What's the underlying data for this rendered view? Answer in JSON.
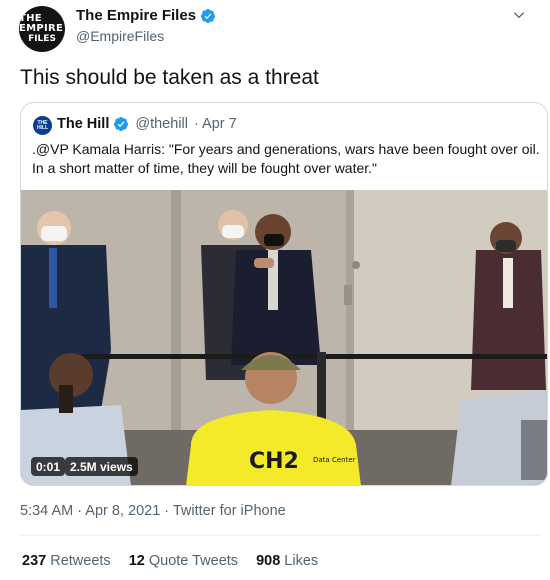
{
  "tweet": {
    "avatar_line1": "THE EMPIRE",
    "avatar_line2": "FILES",
    "author_name": "The Empire Files",
    "author_handle": "@EmpireFiles",
    "text": "This should be taken as a threat",
    "timestamp": "5:34 AM · Apr 8, 2021 · Twitter for iPhone"
  },
  "quoted": {
    "avatar_text": "THE HILL",
    "author_name": "The Hill",
    "author_handle": "@thehill",
    "date": "· Apr 7",
    "text": ".@VP Kamala Harris: \"For years and generations, wars have been fought over oil. In a short matter of time, they will be fought over water.\"",
    "video": {
      "duration": "0:01",
      "views": "2.5M views",
      "shirt_text": "CH2",
      "shirt_subtext": "Data Center"
    }
  },
  "stats": {
    "retweets_count": "237",
    "retweets_label": "Retweets",
    "quotes_count": "12",
    "quotes_label": "Quote Tweets",
    "likes_count": "908",
    "likes_label": "Likes"
  },
  "colors": {
    "verified_blue": "#1d9bf0",
    "secondary_text": "#536471",
    "border": "#cfd9de"
  },
  "icons": [
    "verified-badge-icon",
    "caret-down-icon"
  ]
}
